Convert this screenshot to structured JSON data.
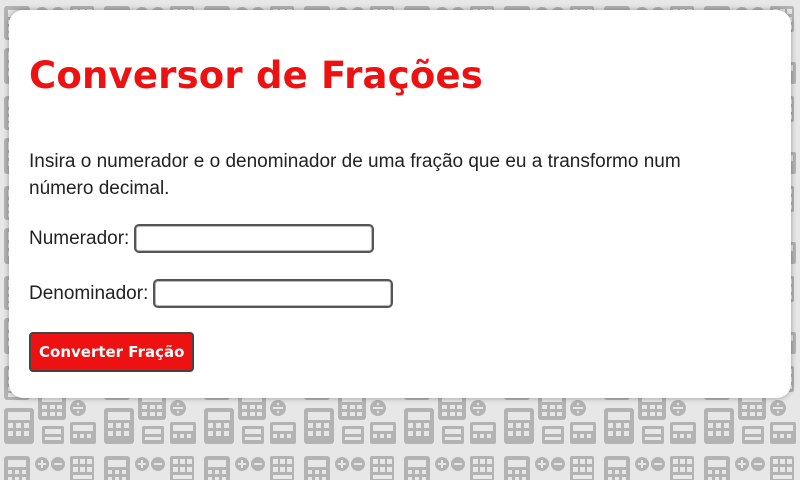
{
  "header": {
    "title": "Conversor de Frações"
  },
  "main": {
    "intro": "Insira o numerador e o denominador de uma fração que eu a transformo num número decimal.",
    "fields": {
      "numerator": {
        "label": "Numerador:",
        "value": ""
      },
      "denominator": {
        "label": "Denominador:",
        "value": ""
      }
    },
    "button_label": "Converter Fração"
  },
  "background": {
    "pattern": "calculator-icons",
    "icon_color": "#b3b3b3",
    "base_color": "#e7e7e7"
  },
  "colors": {
    "accent": "#ee1111",
    "text": "#222222"
  }
}
